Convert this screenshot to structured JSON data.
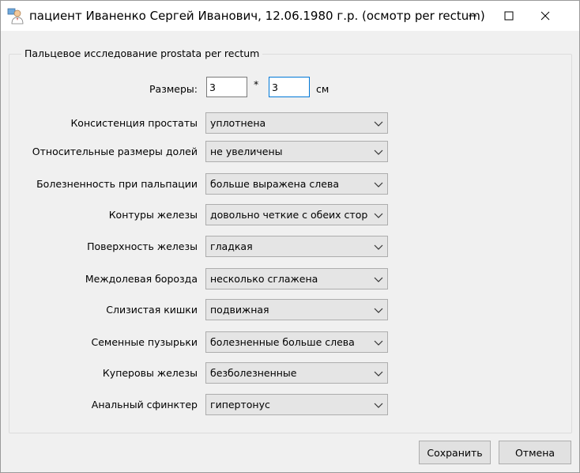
{
  "window": {
    "title": "пациент Иваненко Сергей Иванович, 12.06.1980 г.р. (осмотр per rectum)"
  },
  "group": {
    "title": "Пальцевое исследование prostata per rectum"
  },
  "size": {
    "label": "Размеры:",
    "value1": "3",
    "separator": "*",
    "value2": "3",
    "unit": "см"
  },
  "fields": [
    {
      "label": "Консистенция простаты",
      "value": "уплотнена"
    },
    {
      "label": "Относительные размеры долей",
      "value": "не увеличены"
    },
    {
      "label": "Болезненность при пальпации",
      "value": "больше выражена слева"
    },
    {
      "label": "Контуры железы",
      "value": "довольно четкие с обеих сторон"
    },
    {
      "label": "Поверхность железы",
      "value": "гладкая"
    },
    {
      "label": "Междолевая борозда",
      "value": "несколько сглажена"
    },
    {
      "label": "Слизистая кишки",
      "value": "подвижная"
    },
    {
      "label": "Семенные пузырьки",
      "value": "болезненные больше слева"
    },
    {
      "label": "Куперовы железы",
      "value": "безболезненные"
    },
    {
      "label": "Анальный сфинктер",
      "value": "гипертонус"
    }
  ],
  "buttons": {
    "save": "Сохранить",
    "cancel": "Отмена"
  }
}
